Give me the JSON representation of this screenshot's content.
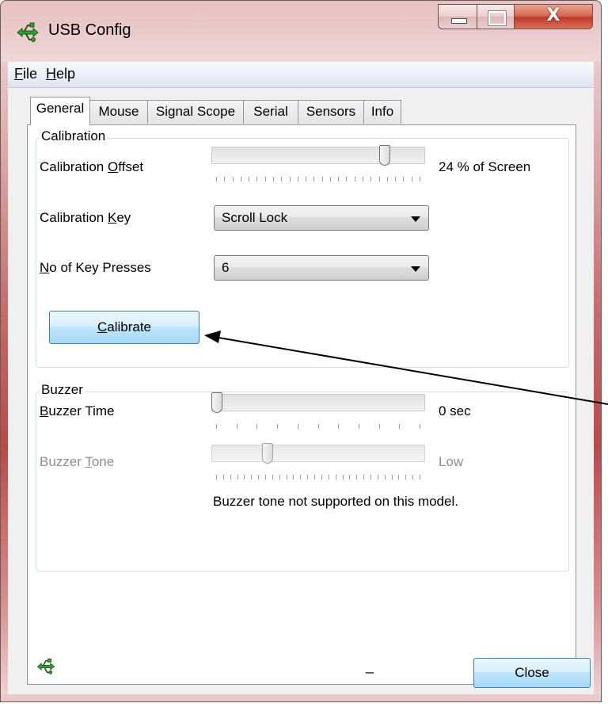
{
  "window": {
    "title": "USB Config",
    "close_glyph": "X",
    "colors": {
      "frame": "#c46a6a",
      "accent": "#3c7fb1",
      "close_button": "#c0392b"
    }
  },
  "menu": {
    "file": {
      "underlined": "F",
      "rest": "ile"
    },
    "help": {
      "underlined": "H",
      "rest": "elp"
    }
  },
  "tabs": [
    "General",
    "Mouse",
    "Signal Scope",
    "Serial",
    "Sensors",
    "Info"
  ],
  "active_tab": "General",
  "calibration": {
    "group_title": "Calibration",
    "offset_label": {
      "before": "Calibration ",
      "underlined": "O",
      "after": "ffset"
    },
    "offset_value": "24 % of Screen",
    "offset_slider_fraction": 0.83,
    "key_label": {
      "before": "Calibration ",
      "underlined": "K",
      "after": "ey"
    },
    "key_value": "Scroll Lock",
    "presses_label": {
      "before": "",
      "underlined": "N",
      "after": "o of Key Presses"
    },
    "presses_value": "6",
    "calibrate_button": {
      "before": "",
      "underlined": "C",
      "after": "alibrate"
    }
  },
  "buzzer": {
    "group_title": "Buzzer",
    "time_label": {
      "before": "",
      "underlined": "B",
      "after": "uzzer Time"
    },
    "time_value": "0 sec",
    "time_slider_fraction": 0.0,
    "tone_label": {
      "before": "Buzzer ",
      "underlined": "T",
      "after": "one"
    },
    "tone_value": "Low",
    "tone_slider_fraction": 0.25,
    "note": "Buzzer tone not supported on this model."
  },
  "footer": {
    "status_text": "_",
    "close_button": "Close"
  },
  "icons": {
    "app": "usb-icon",
    "status": "usb-icon",
    "minimize": "minimize-icon",
    "maximize": "maximize-icon",
    "close": "close-icon"
  }
}
